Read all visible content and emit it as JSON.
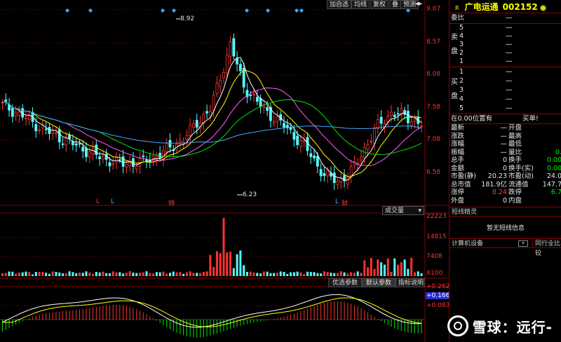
{
  "toolbar": {
    "buttons": [
      "加自选",
      "均线",
      "复权",
      "叠",
      "预测"
    ]
  },
  "price_chart": {
    "yticks": [
      "9.07",
      "8.57",
      "8.08",
      "7.58",
      "7.08",
      "6.58"
    ],
    "high_label": "8.92",
    "low_label": "6.23",
    "markers": [
      "L",
      "L",
      "特",
      "L",
      "财"
    ],
    "volume_dropdown": "成交量"
  },
  "volume_chart": {
    "yticks": [
      "22223",
      "14815",
      "7408",
      "X100"
    ]
  },
  "macd_chart": {
    "tabs": [
      "优选参数",
      "默认参数",
      "指标说明"
    ],
    "yticks": [
      "+0.262",
      "+0.166",
      "+0.083"
    ]
  },
  "stock": {
    "flag": "R",
    "name": "广电运通",
    "code": "002152"
  },
  "order_book": {
    "weibi_label": "委比",
    "weibi_value": "—",
    "sell_label": "卖盘",
    "buy_label": "买盘",
    "sell_levels": [
      {
        "level": "5",
        "value": "—"
      },
      {
        "level": "4",
        "value": "—"
      },
      {
        "level": "3",
        "value": "—"
      },
      {
        "level": "2",
        "value": "—"
      },
      {
        "level": "1",
        "value": "—"
      }
    ],
    "buy_levels": [
      {
        "level": "1",
        "value": "—"
      },
      {
        "level": "2",
        "value": "—"
      },
      {
        "level": "3",
        "value": "—"
      },
      {
        "level": "4",
        "value": "—"
      },
      {
        "level": "5",
        "value": "—"
      }
    ],
    "summary_left": "在0.00位置有",
    "summary_right": "买单!"
  },
  "quote": {
    "rows": [
      {
        "l1": "最新",
        "v1": "—",
        "l2": "开盘",
        "v2": ""
      },
      {
        "l1": "涨跌",
        "v1": "—",
        "l2": "最高",
        "v2": ""
      },
      {
        "l1": "涨幅",
        "v1": "—",
        "l2": "最低",
        "v2": ""
      },
      {
        "l1": "振幅",
        "v1": "—",
        "l2": "量比",
        "v2": "0."
      },
      {
        "l1": "总手",
        "v1": "0",
        "l2": "换手",
        "v2": "0.00"
      },
      {
        "l1": "金额",
        "v1": "0",
        "l2": "换手(实)",
        "v2": "0.00"
      },
      {
        "l1": "市盈(静)",
        "v1": "20.23",
        "l2": "市盈(动)",
        "v2": "24.0"
      },
      {
        "l1": "总市值",
        "v1": "181.9亿",
        "l2": "流通值",
        "v2": "147.7"
      },
      {
        "l1": "涨停",
        "v1": "8.24",
        "l2": "跌停",
        "v2": "6.7"
      },
      {
        "l1": "外盘",
        "v1": "0",
        "l2": "内盘",
        "v2": ""
      }
    ]
  },
  "info": {
    "section_title": "短线精灵",
    "empty_text": "暂无短线信息",
    "industry": "计算机设备",
    "peer": "同行业比较"
  },
  "watermark": {
    "text": "雪球：远行-"
  },
  "colors": {
    "up": "#ff3232",
    "down": "#54ffff",
    "border": "#8a0000",
    "ma5": "#ffffff",
    "ma10": "#ffff00",
    "ma20": "#ff60ff",
    "ma30": "#00e600",
    "ma60": "#3fa9ff"
  }
}
